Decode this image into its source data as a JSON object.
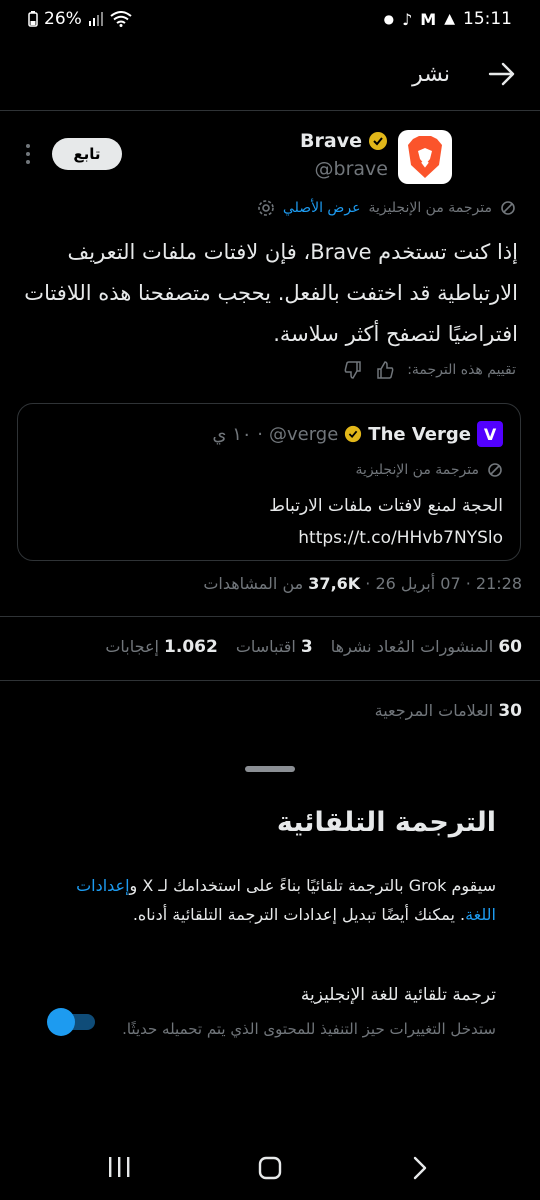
{
  "status_bar": {
    "battery": "26%",
    "time": "15:11"
  },
  "header": {
    "title": "نشر"
  },
  "tweet": {
    "author_name": "Brave",
    "author_handle": "@brave",
    "follow_label": "تابع",
    "translated_from": "مترجمة من الإنجليزية",
    "show_original": "عرض الأصلي",
    "text": "إذا كنت تستخدم Brave، فإن لافتات ملفات التعريف الارتباطية قد اختفت بالفعل. يحجب متصفحنا هذه اللافتات افتراضيًا لتصفح أكثر سلاسة.",
    "rate_translation": "تقييم هذه الترجمة:",
    "timestamp": "21:28 · 07 أبريل 26 · ",
    "views_count": "37,6K",
    "views_label": " من المشاهدات",
    "stats": {
      "reposts_count": "60",
      "reposts_label": "المنشورات المُعاد نشرها",
      "quotes_count": "3",
      "quotes_label": "اقتباسات",
      "likes_count": "1.062",
      "likes_label": "إعجابات",
      "bookmarks_count": "30",
      "bookmarks_label": "العلامات المرجعية"
    }
  },
  "quote": {
    "logo_letter": "V",
    "name": "The Verge",
    "handle": "@verge",
    "time": "· ١٠ ي",
    "translated_from": "مترجمة من الإنجليزية",
    "text": "الحجة لمنع لافتات ملفات الارتباط",
    "link": "https://t.co/HHvb7NYSlo"
  },
  "sheet": {
    "title": "الترجمة التلقائية",
    "desc_part1": "سيقوم Grok بالترجمة تلقائيًا بناءً على استخدامك لـ X و",
    "desc_link": "إعدادات اللغة",
    "desc_part2": ". يمكنك أيضًا تبديل إعدادات الترجمة التلقائية أدناه.",
    "option_label": "ترجمة تلقائية للغة الإنجليزية",
    "option_desc": "ستدخل التغييرات حيز التنفيذ للمحتوى الذي يتم تحميله حديثًا.",
    "toggle_on": true
  },
  "colors": {
    "accent": "#1d9bf0",
    "muted": "#71767b",
    "background": "#000000",
    "brave_orange": "#fb542b",
    "verge_purple": "#5200ff",
    "verified_gold": "#e2b719"
  }
}
